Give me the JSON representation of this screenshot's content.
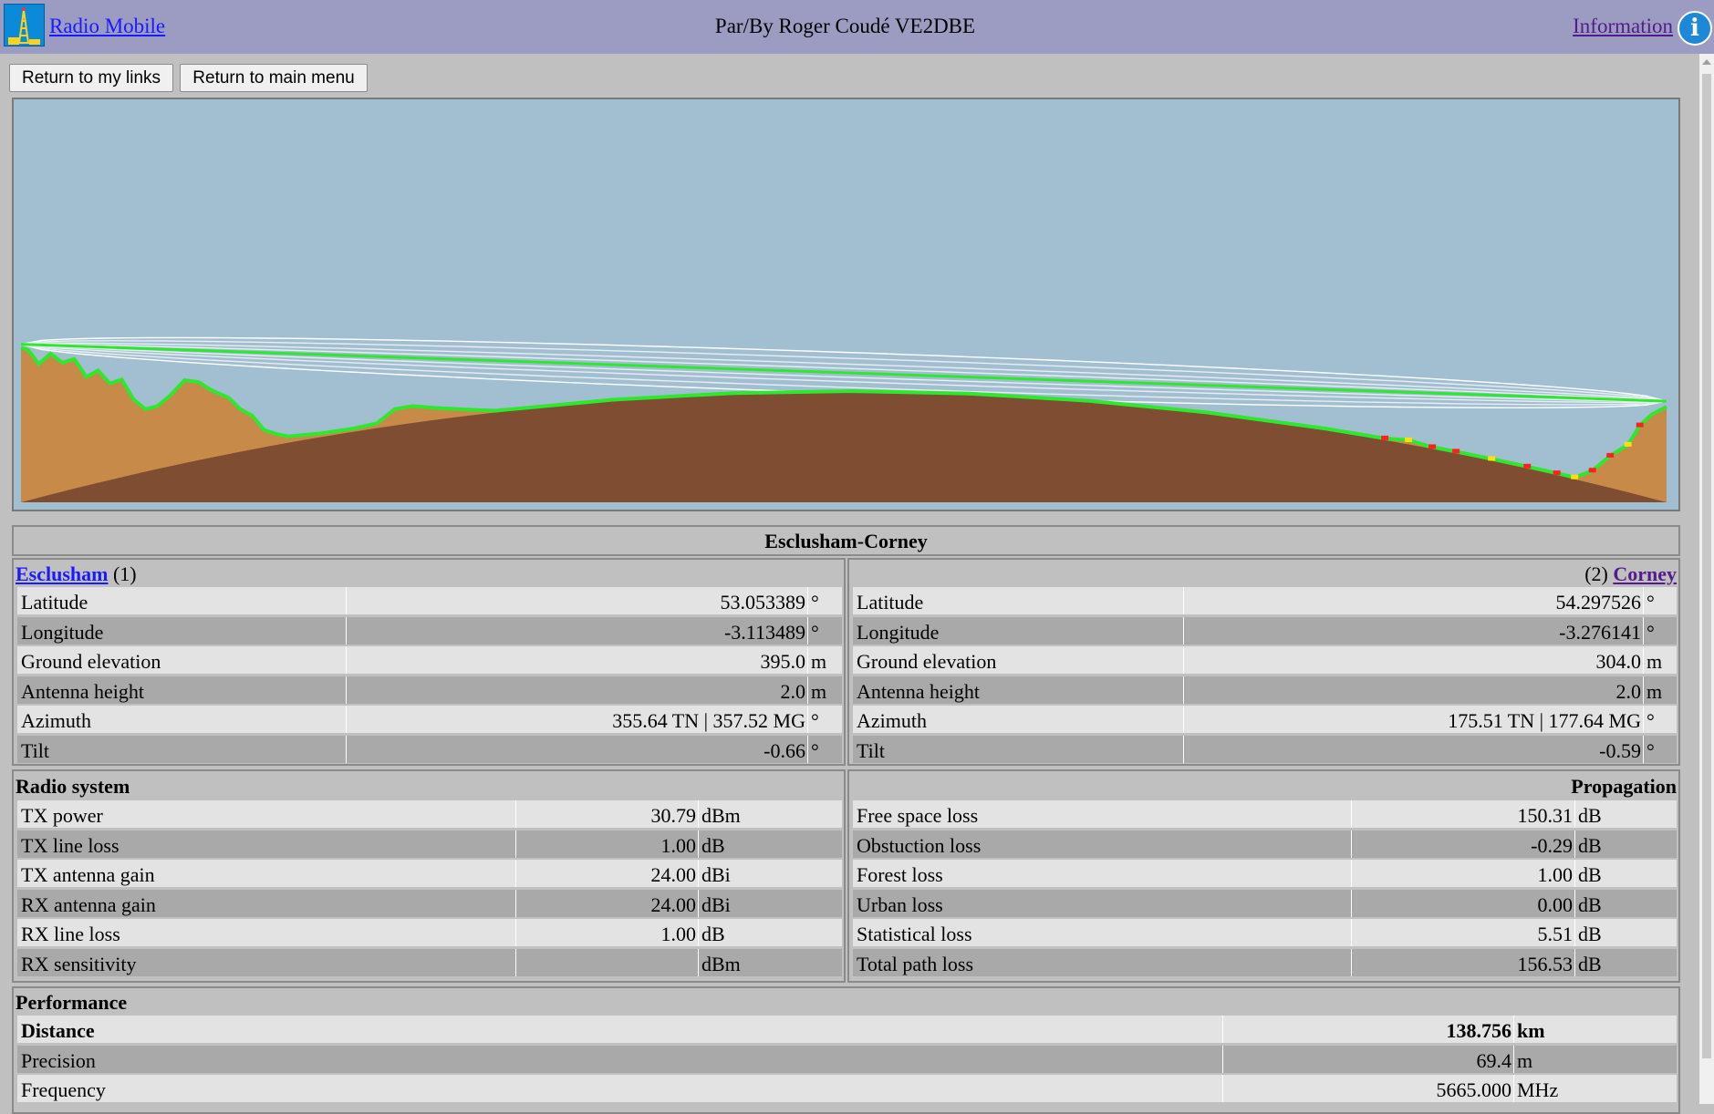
{
  "header": {
    "brand": "Radio Mobile",
    "credit": "Par/By Roger Coudé VE2DBE",
    "info_link": "Information",
    "info_icon": "i"
  },
  "buttons": {
    "links": "Return to my links",
    "menu": "Return to main menu"
  },
  "profile": {
    "colors": {
      "sky": "#a2bfd2",
      "terrain": "#c88a48",
      "earth": "#7f4e32",
      "los": "#2ee82e",
      "obstruction": "#ff2020",
      "fresnel": "#ffffff"
    },
    "earth_bulge_label": "",
    "elevation_km": [
      {
        "d": 0.0,
        "h": 395
      },
      {
        "d": 0.6,
        "h": 392
      },
      {
        "d": 1.5,
        "h": 370
      },
      {
        "d": 2.5,
        "h": 386
      },
      {
        "d": 3.5,
        "h": 372
      },
      {
        "d": 4.5,
        "h": 378
      },
      {
        "d": 5.5,
        "h": 350
      },
      {
        "d": 6.5,
        "h": 360
      },
      {
        "d": 7.5,
        "h": 340
      },
      {
        "d": 8.5,
        "h": 346
      },
      {
        "d": 9.5,
        "h": 315
      },
      {
        "d": 10.5,
        "h": 300
      },
      {
        "d": 11.5,
        "h": 305
      },
      {
        "d": 12.5,
        "h": 320
      },
      {
        "d": 13.8,
        "h": 345
      },
      {
        "d": 15.0,
        "h": 342
      },
      {
        "d": 16.0,
        "h": 330
      },
      {
        "d": 17.5,
        "h": 318
      },
      {
        "d": 18.5,
        "h": 300
      },
      {
        "d": 19.5,
        "h": 290
      },
      {
        "d": 20.5,
        "h": 268
      },
      {
        "d": 21.5,
        "h": 262
      },
      {
        "d": 22.5,
        "h": 258
      },
      {
        "d": 25.0,
        "h": 262
      },
      {
        "d": 28.0,
        "h": 270
      },
      {
        "d": 30.0,
        "h": 278
      },
      {
        "d": 31.5,
        "h": 300
      },
      {
        "d": 33.0,
        "h": 305
      },
      {
        "d": 35.0,
        "h": 302
      },
      {
        "d": 37.0,
        "h": 300
      },
      {
        "d": 40.0,
        "h": 290
      },
      {
        "d": 50.0,
        "h": 300
      },
      {
        "d": 60.0,
        "h": 306
      },
      {
        "d": 70.0,
        "h": 307
      },
      {
        "d": 80.0,
        "h": 303
      },
      {
        "d": 90.0,
        "h": 295
      },
      {
        "d": 100.0,
        "h": 278
      },
      {
        "d": 110.0,
        "h": 256
      },
      {
        "d": 115.0,
        "h": 244
      },
      {
        "d": 117.0,
        "h": 252
      },
      {
        "d": 119.0,
        "h": 236
      },
      {
        "d": 121.0,
        "h": 222
      },
      {
        "d": 124.0,
        "h": 210
      },
      {
        "d": 127.0,
        "h": 196
      },
      {
        "d": 129.5,
        "h": 178
      },
      {
        "d": 131.0,
        "h": 188
      },
      {
        "d": 132.5,
        "h": 205
      },
      {
        "d": 134.0,
        "h": 228
      },
      {
        "d": 135.5,
        "h": 245
      },
      {
        "d": 136.5,
        "h": 275
      },
      {
        "d": 137.5,
        "h": 292
      },
      {
        "d": 138.756,
        "h": 304
      }
    ]
  },
  "link_title": "Esclusham-Corney",
  "site1": {
    "name": "Esclusham",
    "num": "(1)",
    "rows": [
      {
        "label": "Latitude",
        "value": "53.053389",
        "unit": "°"
      },
      {
        "label": "Longitude",
        "value": "-3.113489",
        "unit": "°"
      },
      {
        "label": "Ground elevation",
        "value": "395.0",
        "unit": "m"
      },
      {
        "label": "Antenna height",
        "value": "2.0",
        "unit": "m"
      },
      {
        "label": "Azimuth",
        "value": "355.64 TN | 357.52 MG",
        "unit": "°"
      },
      {
        "label": "Tilt",
        "value": "-0.66",
        "unit": "°"
      }
    ]
  },
  "site2": {
    "name": "Corney",
    "num": "(2)",
    "rows": [
      {
        "label": "Latitude",
        "value": "54.297526",
        "unit": "°"
      },
      {
        "label": "Longitude",
        "value": "-3.276141",
        "unit": "°"
      },
      {
        "label": "Ground elevation",
        "value": "304.0",
        "unit": "m"
      },
      {
        "label": "Antenna height",
        "value": "2.0",
        "unit": "m"
      },
      {
        "label": "Azimuth",
        "value": "175.51 TN | 177.64 MG",
        "unit": "°"
      },
      {
        "label": "Tilt",
        "value": "-0.59",
        "unit": "°"
      }
    ]
  },
  "radio": {
    "title": "Radio system",
    "rows": [
      {
        "label": "TX power",
        "value": "30.79",
        "unit": "dBm"
      },
      {
        "label": "TX line loss",
        "value": "1.00",
        "unit": "dB"
      },
      {
        "label": "TX antenna gain",
        "value": "24.00",
        "unit": "dBi"
      },
      {
        "label": "RX antenna gain",
        "value": "24.00",
        "unit": "dBi"
      },
      {
        "label": "RX line loss",
        "value": "1.00",
        "unit": "dB"
      },
      {
        "label": "RX sensitivity",
        "value": "",
        "unit": "dBm"
      }
    ]
  },
  "propagation": {
    "title": "Propagation",
    "rows": [
      {
        "label": "Free space loss",
        "value": "150.31",
        "unit": "dB"
      },
      {
        "label": "Obstuction loss",
        "value": "-0.29",
        "unit": "dB"
      },
      {
        "label": "Forest loss",
        "value": "1.00",
        "unit": "dB"
      },
      {
        "label": "Urban loss",
        "value": "0.00",
        "unit": "dB"
      },
      {
        "label": "Statistical loss",
        "value": "5.51",
        "unit": "dB"
      },
      {
        "label": "Total path loss",
        "value": "156.53",
        "unit": "dB"
      }
    ]
  },
  "performance": {
    "title": "Performance",
    "rows": [
      {
        "label": "Distance",
        "value": "138.756",
        "unit": "km",
        "bold": true
      },
      {
        "label": "Precision",
        "value": "69.4",
        "unit": "m"
      },
      {
        "label": "Frequency",
        "value": "5665.000",
        "unit": "MHz"
      }
    ]
  }
}
